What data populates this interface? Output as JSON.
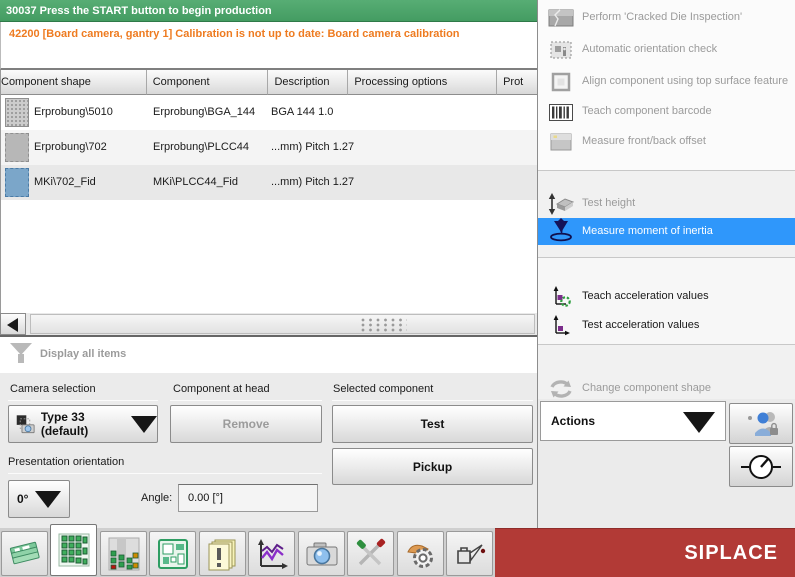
{
  "status_bar": {
    "message": "30037 Press the START button to begin production"
  },
  "warning": {
    "message": "42200 [Board camera, gantry 1] Calibration is not up to date: Board camera calibration"
  },
  "table": {
    "columns": [
      "Component shape",
      "Component",
      "Description",
      "Processing options",
      "Prot"
    ],
    "rows": [
      {
        "component_shape": "Erprobung\\5010",
        "component": "Erprobung\\BGA_144",
        "description": "BGA 144 1.0",
        "shape_icon": "bga-shape-icon"
      },
      {
        "component_shape": "Erprobung\\702",
        "component": "Erprobung\\PLCC44",
        "description": "...mm)  Pitch 1.27",
        "shape_icon": "plcc-shape-icon"
      },
      {
        "component_shape": "MKi\\702_Fid",
        "component": "MKi\\PLCC44_Fid",
        "description": "...mm)  Pitch 1.27",
        "shape_icon": "fiducial-shape-icon"
      }
    ]
  },
  "filter": {
    "label": "Display all items"
  },
  "controls": {
    "camera_selection_label": "Camera selection",
    "component_at_head_label": "Component at head",
    "selected_component_label": "Selected component",
    "camera_type_value": "Type 33 (default)",
    "remove_label": "Remove",
    "test_label": "Test",
    "pickup_label": "Pickup",
    "presentation_orientation_label": "Presentation orientation",
    "orientation_value": "0°",
    "angle_label": "Angle:",
    "angle_value": "0.00 [°]"
  },
  "menu": {
    "items": [
      {
        "label": "Perform 'Cracked Die Inspection'",
        "state": "disabled"
      },
      {
        "label": "Automatic orientation check",
        "state": "disabled"
      },
      {
        "label": "Align component using top surface feature",
        "state": "disabled"
      },
      {
        "label": "Teach component barcode",
        "state": "disabled"
      },
      {
        "label": "Measure front/back offset",
        "state": "disabled"
      },
      {
        "label": "Test height",
        "state": "disabled"
      },
      {
        "label": "Measure moment of inertia",
        "state": "selected"
      },
      {
        "label": "Teach acceleration values",
        "state": "enabled"
      },
      {
        "label": "Test acceleration values",
        "state": "enabled"
      },
      {
        "label": "Change component shape",
        "state": "disabled"
      }
    ],
    "actions_label": "Actions"
  },
  "brand": {
    "logo": "SIPLACE"
  },
  "colors": {
    "status_green": "#4BA466",
    "warning_orange": "#EE7B20",
    "selection_blue": "#2F97FB",
    "brand_red": "#B23A36"
  }
}
